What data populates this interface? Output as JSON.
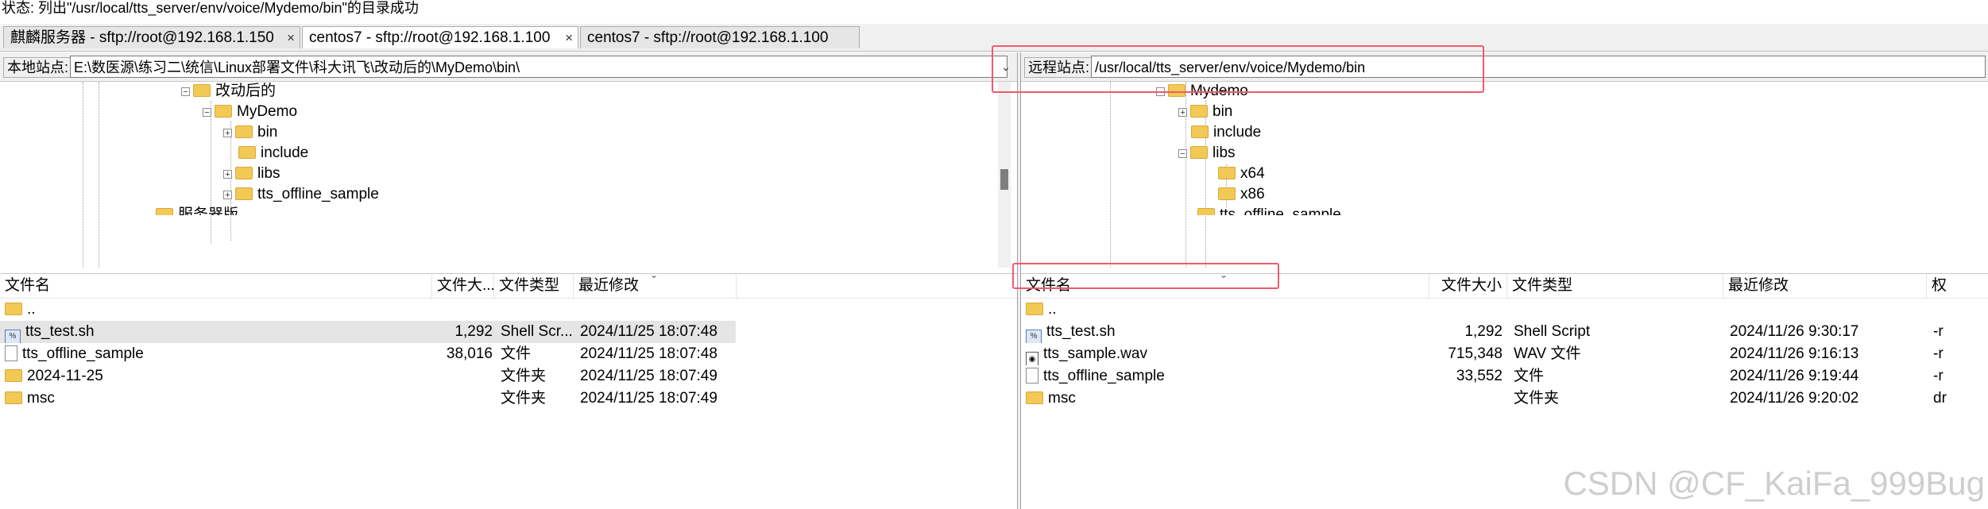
{
  "status_line": "状态: 列出\"/usr/local/tts_server/env/voice/Mydemo/bin\"的目录成功",
  "tabs": [
    {
      "label": "麒麟服务器 - sftp://root@192.168.1.150",
      "close": "×"
    },
    {
      "label": "centos7 - sftp://root@192.168.1.100",
      "close": "×"
    },
    {
      "label": "centos7 - sftp://root@192.168.1.100",
      "close": ""
    }
  ],
  "left": {
    "site_label": "本地站点:",
    "site_path": "E:\\数医源\\练习二\\统信\\Linux部署文件\\科大讯飞\\改动后的\\MyDemo\\bin\\",
    "tree": [
      {
        "label": "改动后的",
        "expander": "−"
      },
      {
        "label": "MyDemo",
        "expander": "−"
      },
      {
        "label": "bin",
        "expander": "+"
      },
      {
        "label": "include",
        "expander": ""
      },
      {
        "label": "libs",
        "expander": "+"
      },
      {
        "label": "tts_offline_sample",
        "expander": "+"
      },
      {
        "label": "服务器版",
        "expander": ""
      }
    ],
    "columns": {
      "name": "文件名",
      "size": "文件大...",
      "type": "文件类型",
      "modified": "最近修改"
    },
    "files": [
      {
        "name": "..",
        "size": "",
        "type": "",
        "modified": "",
        "icon": "folder-icon"
      },
      {
        "name": "tts_test.sh",
        "size": "1,292",
        "type": "Shell Scr...",
        "modified": "2024/11/25 18:07:48",
        "icon": "script-icon"
      },
      {
        "name": "tts_offline_sample",
        "size": "38,016",
        "type": "文件",
        "modified": "2024/11/25 18:07:48",
        "icon": "file-icon"
      },
      {
        "name": "2024-11-25",
        "size": "",
        "type": "文件夹",
        "modified": "2024/11/25 18:07:49",
        "icon": "folder-icon"
      },
      {
        "name": "msc",
        "size": "",
        "type": "文件夹",
        "modified": "2024/11/25 18:07:49",
        "icon": "folder-icon"
      }
    ]
  },
  "right": {
    "site_label": "远程站点:",
    "site_path": "/usr/local/tts_server/env/voice/Mydemo/bin",
    "tree": [
      {
        "label": "Mydemo",
        "expander": "−"
      },
      {
        "label": "bin",
        "expander": "+"
      },
      {
        "label": "include",
        "expander": ""
      },
      {
        "label": "libs",
        "expander": "−"
      },
      {
        "label": "x64",
        "expander": ""
      },
      {
        "label": "x86",
        "expander": ""
      },
      {
        "label": "tts_offline_sample",
        "expander": ""
      }
    ],
    "columns": {
      "name": "文件名",
      "size": "文件大小",
      "type": "文件类型",
      "modified": "最近修改",
      "perm": "权"
    },
    "files": [
      {
        "name": "..",
        "size": "",
        "type": "",
        "modified": "",
        "perm": "",
        "icon": "folder-icon"
      },
      {
        "name": "tts_test.sh",
        "size": "1,292",
        "type": "Shell Script",
        "modified": "2024/11/26 9:30:17",
        "perm": "-r",
        "icon": "script-icon"
      },
      {
        "name": "tts_sample.wav",
        "size": "715,348",
        "type": "WAV 文件",
        "modified": "2024/11/26 9:16:13",
        "perm": "-r",
        "icon": "wav-icon"
      },
      {
        "name": "tts_offline_sample",
        "size": "33,552",
        "type": "文件",
        "modified": "2024/11/26 9:19:44",
        "perm": "-r",
        "icon": "file-icon"
      },
      {
        "name": "msc",
        "size": "",
        "type": "文件夹",
        "modified": "2024/11/26 9:20:02",
        "perm": "dr",
        "icon": "folder-icon"
      }
    ]
  },
  "watermark": "CSDN @CF_KaiFa_999Bug",
  "colors": {
    "highlight": "#f15a6c",
    "folder": "#f2c955",
    "selected_row": "#e5e5e5"
  }
}
